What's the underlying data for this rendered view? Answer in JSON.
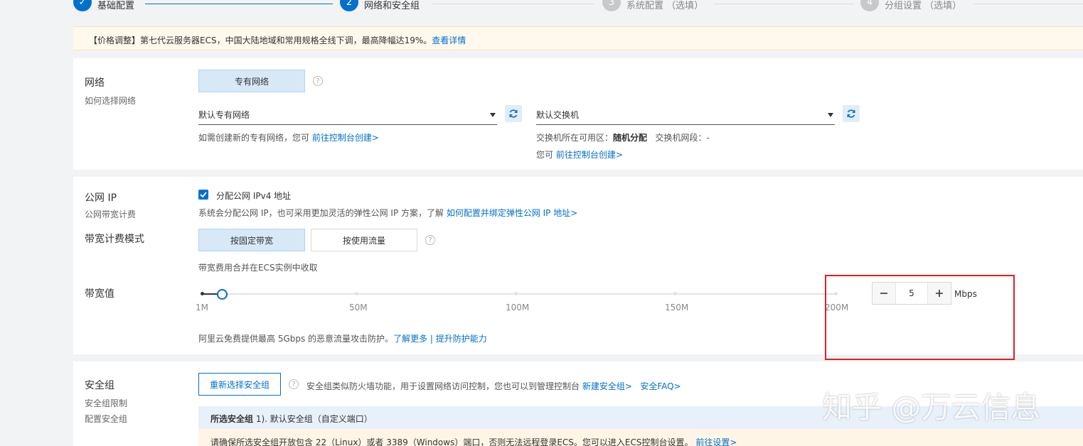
{
  "steps": [
    {
      "num": "✓",
      "label": "基础配置",
      "state": "done"
    },
    {
      "num": "2",
      "label": "网络和安全组",
      "state": "active"
    },
    {
      "num": "3",
      "label": "系统配置 （选填）",
      "state": "todo"
    },
    {
      "num": "4",
      "label": "分组设置 （选填）",
      "state": "todo"
    }
  ],
  "notice": {
    "text": "【价格调整】第七代云服务器ECS，中国大陆地域和常用规格全线下调，最高降幅达19%。",
    "link": "查看详情"
  },
  "network": {
    "title": "网络",
    "subtitle": "如何选择网络",
    "type_button": "专有网络",
    "vpc_select": "默认专有网络",
    "vpc_hint": "如需创建新的专有网络，您可",
    "vpc_hint_link": "前往控制台创建>",
    "vswitch_select": "默认交换机",
    "zone_label": "交换机所在可用区：",
    "zone_value": "随机分配",
    "cidr_label": "交换机网段：",
    "cidr_value": "-",
    "vswitch_hint": "您可",
    "vswitch_hint_link": "前往控制台创建>"
  },
  "public_ip": {
    "title": "公网 IP",
    "subtitle": "公网带宽计费",
    "checkbox_label": "分配公网 IPv4 地址",
    "checked": true,
    "desc": "系统会分配公网 IP，也可采用更加灵活的弹性公网 IP 方案，了解",
    "desc_link": "如何配置并绑定弹性公网 IP 地址>",
    "billing_title": "带宽计费模式",
    "billing_options": [
      "按固定带宽",
      "按使用流量"
    ],
    "billing_selected": "按固定带宽",
    "billing_hint": "带宽费用合并在ECS实例中收取",
    "bandwidth_title": "带宽值",
    "slider_ticks": [
      "1M",
      "50M",
      "100M",
      "150M",
      "200M"
    ],
    "slider_min": 1,
    "slider_max": 200,
    "bandwidth_value": "5",
    "bandwidth_unit": "Mbps",
    "ddos_text": "阿里云免费提供最高 5Gbps 的恶意流量攻击防护。",
    "ddos_link1": "了解更多",
    "ddos_sep": "|",
    "ddos_link2": "提升防护能力"
  },
  "security_group": {
    "title": "安全组",
    "subtitle1": "安全组限制",
    "subtitle2": "配置安全组",
    "reselect_button": "重新选择安全组",
    "desc": "安全组类似防火墙功能，用于设置网络访问控制，您也可以到管理控制台",
    "link1": "新建安全组>",
    "link2": "安全FAQ>",
    "selected_label": "所选安全组",
    "selected_value": "1). 默认安全组（自定义端口）",
    "warning": "请确保所选安全组开放包含 22（Linux）或者 3389（Windows）端口，否则无法远程登录ECS。您可以进入ECS控制台设置。",
    "warning_link": "前往设置>"
  },
  "watermark": "知乎 @万云信息",
  "colors": {
    "primary": "#0070cc",
    "highlight_box": "#e02020",
    "notice_bg": "#fff8ec"
  }
}
